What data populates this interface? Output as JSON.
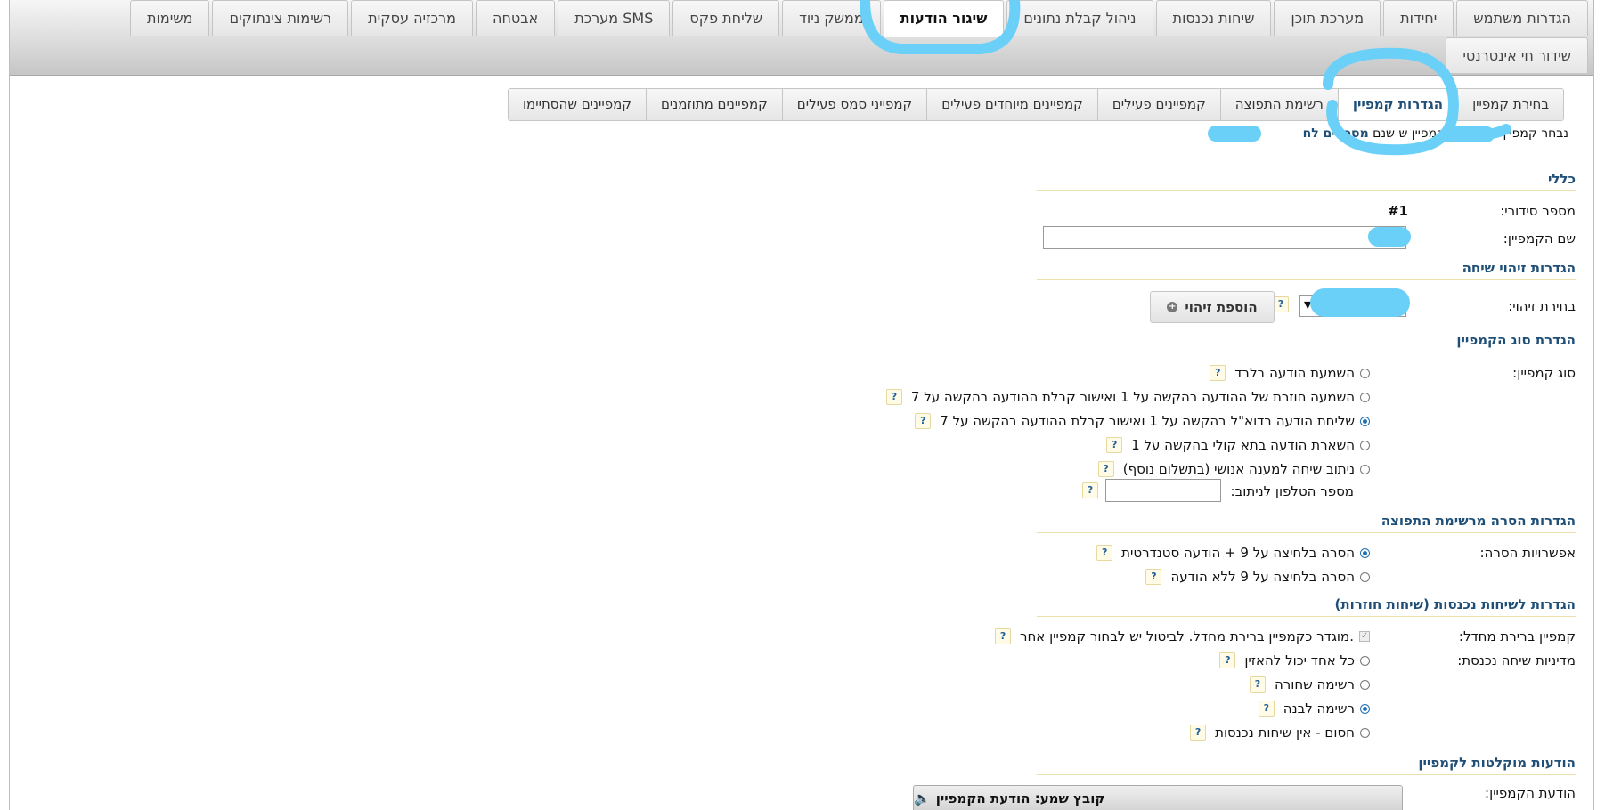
{
  "main_tabs_row1": [
    "הגדרות משתמש",
    "יחידות",
    "מערכת תוכן",
    "שיחות נכנסות",
    "ניהול קבלת נתונים",
    "שיגור הודעות",
    "ממשק ניוד",
    "שליחת פקס",
    "מערכת SMS",
    "אבטחה",
    "מרכזיה עסקית",
    "רשימות צינתוקים",
    "משימות"
  ],
  "main_tabs_row2": [
    "שידור חי אינטרנטי"
  ],
  "active_main_tab": "שיגור הודעות",
  "sub_tabs": [
    "בחירת קמפיין",
    "הגדרות קמפיין",
    "רשימת התפוצה",
    "קמפיינים פעילים",
    "קמפיינים מיוחדים פעילים",
    "קמפייני סמס פעילים",
    "קמפיינים מתוזמנים",
    "קמפיינים שהסתיימו"
  ],
  "active_sub_tab": "הגדרות קמפיין",
  "notice": {
    "text": "נבחר קמפיין",
    "mid": "קמפיין ש",
    "tail": "שנם",
    "link": "מספרים לח"
  },
  "sections": {
    "general": "כללי",
    "id_settings": "הגדרות זיהוי שיחה",
    "type_settings": "הגדרת סוג הקמפיין",
    "removal_settings": "הגדרות הסרה מרשימת התפוצה",
    "incoming_settings": "הגדרות לשיחות נכנסות (שיחות חוזרות)",
    "messages": "הודעות מוקלטות לקמפיין"
  },
  "labels": {
    "serial": "מספר סידורי:",
    "name": "שם הקמפיין:",
    "id_select": "בחירת זיהוי:",
    "type": "סוג קמפיין:",
    "removal": "אפשרויות הסרה:",
    "default_campaign": "קמפיין ברירת מחדל:",
    "incoming_policy": "מדיניות שיחה נכנסת:",
    "campaign_message": "הודעת הקמפיין:"
  },
  "serial_value": "#1",
  "help_mark": "?",
  "add_id_button": "הוספת זיהוי",
  "campaign_types": [
    {
      "label": "השמעת הודעה בלבד",
      "checked": false
    },
    {
      "label": "השמעה חוזרת של ההודעה בהקשה על 1 ואישור קבלת ההודעה בהקשה על 7",
      "checked": false
    },
    {
      "label": "שליחת הודעה בדוא\"ל בהקשה על 1 ואישור קבלת ההודעה בהקשה על 7",
      "checked": true
    },
    {
      "label": "השארת הודעה בתא קולי בהקשה על 1",
      "checked": false
    },
    {
      "label": "ניתוב שיחה למענה אנושי (בתשלום נוסף)",
      "checked": false
    }
  ],
  "routing_phone_label": "מספר הטלפון לניתוב:",
  "removal_options": [
    {
      "label": "הסרה בלחיצה על 9 + הודעה סטנדרטית",
      "checked": true
    },
    {
      "label": "הסרה בלחיצה על 9 ללא הודעה",
      "checked": false
    }
  ],
  "default_campaign_text": "מוגדר כקמפיין ברירת מחדל. לביטול יש לבחור קמפיין אחר.",
  "incoming_policies": [
    {
      "label": "כל אחד יכול להאזין",
      "checked": false
    },
    {
      "label": "רשימה שחורה",
      "checked": false
    },
    {
      "label": "רשימה לבנה",
      "checked": true
    },
    {
      "label": "חסום - אין שיחות נכנסות",
      "checked": false
    }
  ],
  "audio_player_title": "קובץ שמע: הודעת הקמפיין",
  "colors": {
    "accent": "#1f4f76",
    "annotation": "#6bd0f7"
  }
}
